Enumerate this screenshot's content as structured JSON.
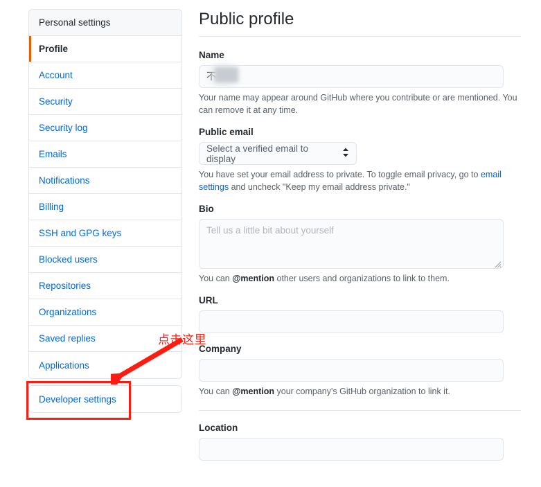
{
  "sidebar": {
    "header": "Personal settings",
    "items": [
      {
        "label": "Profile",
        "selected": true
      },
      {
        "label": "Account",
        "selected": false
      },
      {
        "label": "Security",
        "selected": false
      },
      {
        "label": "Security log",
        "selected": false
      },
      {
        "label": "Emails",
        "selected": false
      },
      {
        "label": "Notifications",
        "selected": false
      },
      {
        "label": "Billing",
        "selected": false
      },
      {
        "label": "SSH and GPG keys",
        "selected": false
      },
      {
        "label": "Blocked users",
        "selected": false
      },
      {
        "label": "Repositories",
        "selected": false
      },
      {
        "label": "Organizations",
        "selected": false
      },
      {
        "label": "Saved replies",
        "selected": false
      },
      {
        "label": "Applications",
        "selected": false
      }
    ],
    "developer_settings": "Developer settings"
  },
  "main": {
    "title": "Public profile",
    "name": {
      "label": "Name",
      "value": "不",
      "helper_prefix": "Your name may appear around GitHub where you contribute or are mentioned. You can remove it at any time."
    },
    "public_email": {
      "label": "Public email",
      "selected_option": "Select a verified email to display",
      "caret": "chevron-up-down",
      "helper_before_link": "You have set your email address to private. To toggle email privacy, go to ",
      "helper_link": "email settings",
      "helper_after_link": " and uncheck \"Keep my email address private.\""
    },
    "bio": {
      "label": "Bio",
      "placeholder": "Tell us a little bit about yourself",
      "value": "",
      "helper_pre": "You can ",
      "helper_bold": "@mention",
      "helper_post": " other users and organizations to link to them."
    },
    "url": {
      "label": "URL",
      "value": "",
      "placeholder": ""
    },
    "company": {
      "label": "Company",
      "value": "",
      "placeholder": "",
      "helper_pre": "You can ",
      "helper_bold": "@mention",
      "helper_post": " your company's GitHub organization to link it."
    },
    "location": {
      "label": "Location",
      "value": "",
      "placeholder": ""
    }
  },
  "annotations": {
    "callout_text": "点击这里",
    "color": "#fd1c11"
  },
  "colors": {
    "link": "#0366d6",
    "accent_orange": "#e36209",
    "border": "#e1e4e8",
    "header_bg": "#f6f8fa",
    "input_bg": "#fafbfc",
    "text": "#24292e",
    "muted": "#586069",
    "annotation_red": "#fd1c11"
  }
}
